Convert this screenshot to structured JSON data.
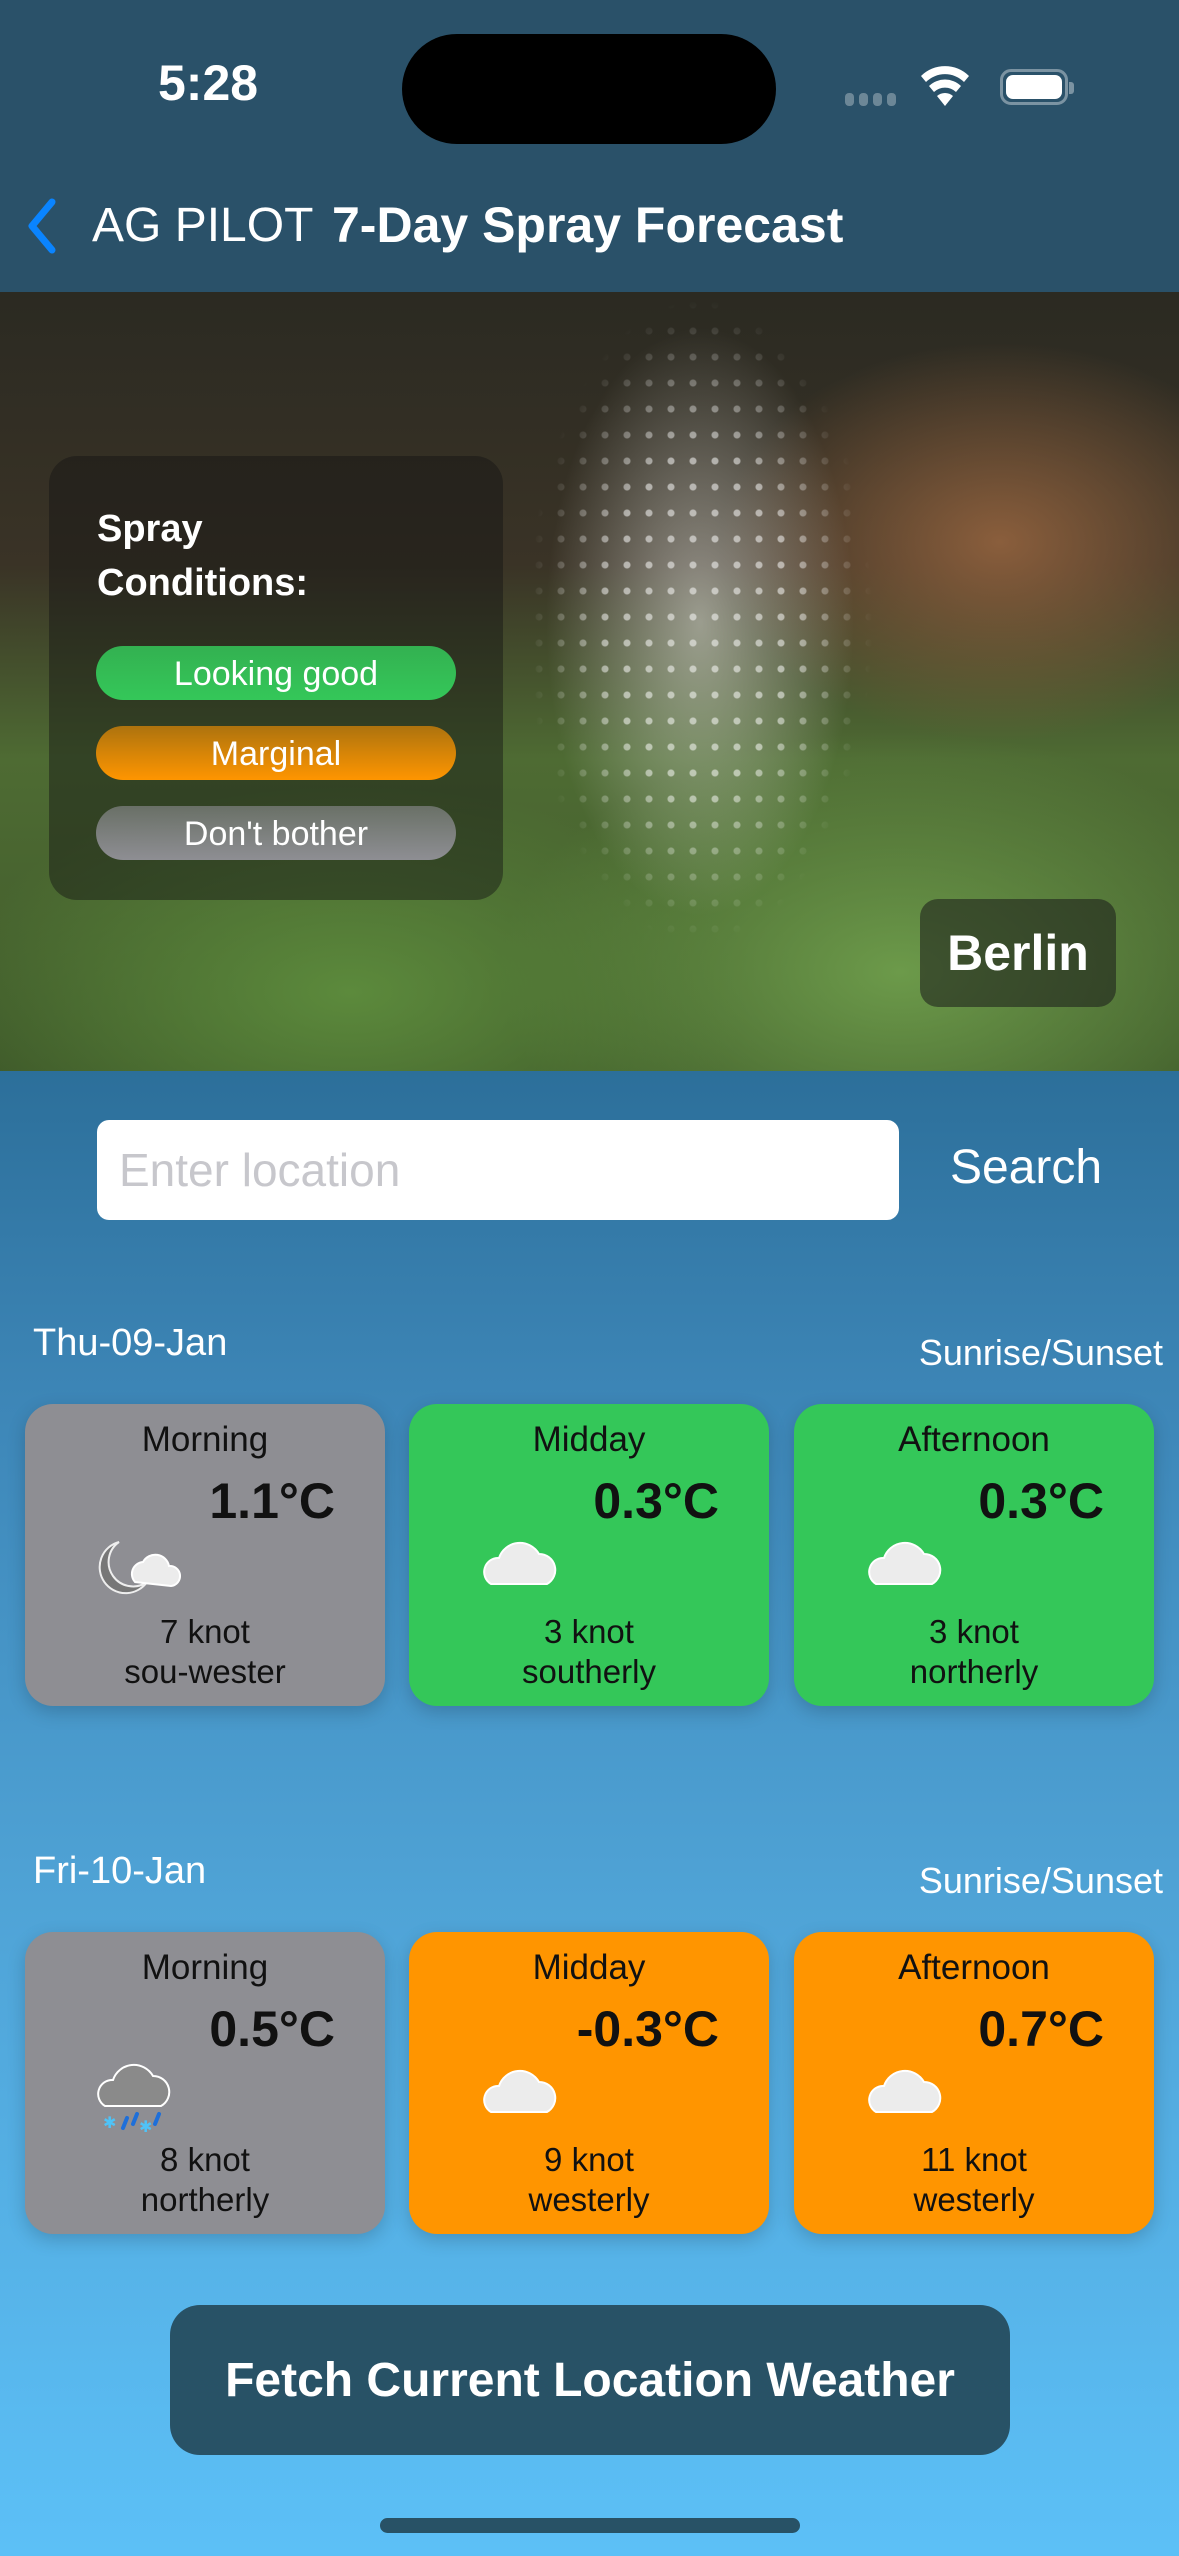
{
  "status_bar": {
    "time": "5:28"
  },
  "nav": {
    "back_label": "AG PILOT",
    "title": "7-Day Spray Forecast"
  },
  "hero": {
    "legend_title": "Spray Conditions:",
    "legend": [
      {
        "label": "Looking good",
        "color": "#34c759"
      },
      {
        "label": "Marginal",
        "color": "#ff9500"
      },
      {
        "label": "Don't bother",
        "color": "#8e8e93"
      }
    ],
    "city": "Berlin"
  },
  "search": {
    "placeholder": "Enter location",
    "value": "",
    "button_label": "Search"
  },
  "days": [
    {
      "date": "Thu-09-Jan",
      "sun_label": "Sunrise/Sunset",
      "periods": [
        {
          "name": "Morning",
          "temp": "1.1°C",
          "icon": "moon-cloud-icon",
          "wind_speed": "7 knot",
          "wind_dir": "sou-wester",
          "condition": "Don't bother"
        },
        {
          "name": "Midday",
          "temp": "0.3°C",
          "icon": "cloud-icon",
          "wind_speed": "3 knot",
          "wind_dir": "southerly",
          "condition": "Looking good"
        },
        {
          "name": "Afternoon",
          "temp": "0.3°C",
          "icon": "cloud-icon",
          "wind_speed": "3 knot",
          "wind_dir": "northerly",
          "condition": "Looking good"
        }
      ]
    },
    {
      "date": "Fri-10-Jan",
      "sun_label": "Sunrise/Sunset",
      "periods": [
        {
          "name": "Morning",
          "temp": "0.5°C",
          "icon": "sleet-cloud-icon",
          "wind_speed": "8 knot",
          "wind_dir": "northerly",
          "condition": "Don't bother"
        },
        {
          "name": "Midday",
          "temp": "-0.3°C",
          "icon": "cloud-icon",
          "wind_speed": "9 knot",
          "wind_dir": "westerly",
          "condition": "Marginal"
        },
        {
          "name": "Afternoon",
          "temp": "0.7°C",
          "icon": "cloud-icon",
          "wind_speed": "11 knot",
          "wind_dir": "westerly",
          "condition": "Marginal"
        }
      ]
    }
  ],
  "fetch_button_label": "Fetch Current Location Weather",
  "colors": {
    "header": "#2a5169",
    "accent_back": "#0a84ff",
    "good": "#34c759",
    "marginal": "#ff9500",
    "bad": "#8e8e93",
    "button": "#285266"
  }
}
